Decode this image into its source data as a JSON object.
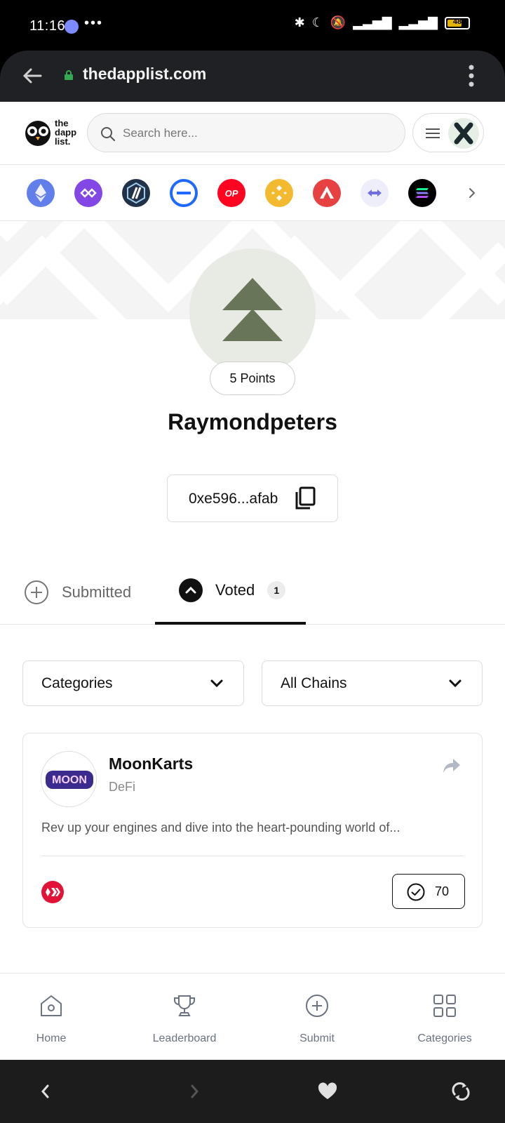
{
  "status_bar": {
    "time": "11:16",
    "dots": "•••",
    "battery": "48"
  },
  "browser": {
    "url": "thedapplist.com"
  },
  "header": {
    "logo_lines": [
      "the",
      "dapp",
      "list."
    ],
    "search_placeholder": "Search here..."
  },
  "chains": [
    {
      "name": "ethereum",
      "color": "#627eea"
    },
    {
      "name": "polygon",
      "color": "#8247e5"
    },
    {
      "name": "arbitrum",
      "color": "#213147"
    },
    {
      "name": "zksync",
      "color": "#1e69ff"
    },
    {
      "name": "optimism",
      "color": "#ff0420",
      "label": "OP"
    },
    {
      "name": "bnb",
      "color": "#f3ba2f"
    },
    {
      "name": "avalanche",
      "color": "#e84142"
    },
    {
      "name": "bridge",
      "color": "#eeeefb"
    },
    {
      "name": "solana",
      "color": "#000000"
    }
  ],
  "profile": {
    "points": "5 Points",
    "username": "Raymondpeters",
    "wallet": "0xe596...afab"
  },
  "tabs": {
    "submitted": "Submitted",
    "voted": "Voted",
    "voted_count": "1"
  },
  "filters": {
    "categories": "Categories",
    "chains": "All Chains"
  },
  "card": {
    "name": "MoonKarts",
    "category": "DeFi",
    "description": "Rev up your engines and dive into the heart-pounding world of...",
    "votes": "70",
    "logo_text": "MOON"
  },
  "bottom_nav": {
    "home": "Home",
    "leaderboard": "Leaderboard",
    "submit": "Submit",
    "categories": "Categories"
  }
}
